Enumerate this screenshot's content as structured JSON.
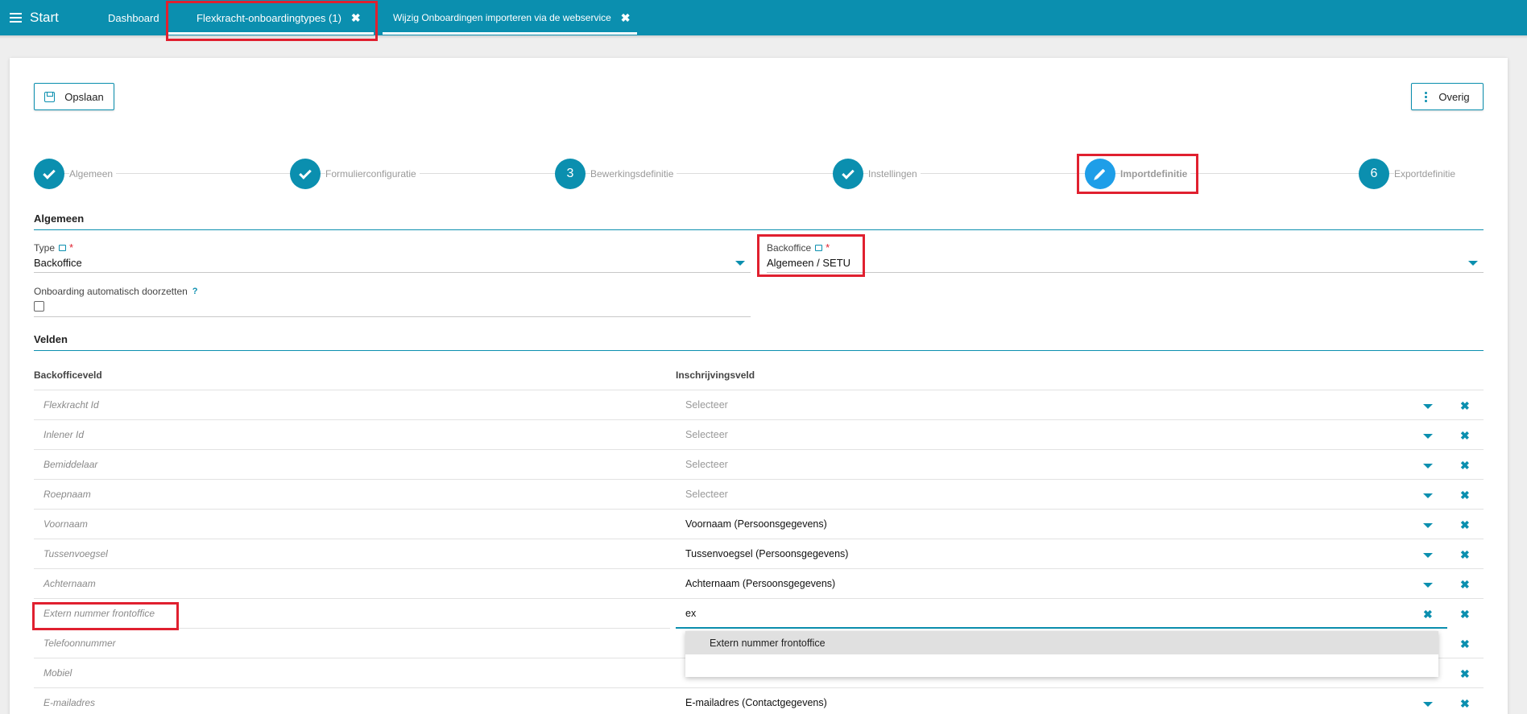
{
  "topbar": {
    "start_label": "Start",
    "tabs": [
      {
        "label": "Dashboard"
      },
      {
        "label": "Flexkracht-onboardingtypes (1)",
        "close": "✖"
      },
      {
        "label": "Wijzig Onboardingen importeren via de webservice",
        "close": "✖"
      }
    ]
  },
  "toolbar": {
    "save_label": "Opslaan",
    "overig_label": "Overig"
  },
  "stepper": {
    "steps": [
      {
        "label": "Algemeen",
        "state": "done"
      },
      {
        "label": "Formulierconfiguratie",
        "state": "done"
      },
      {
        "label": "Bewerkingsdefinitie",
        "state": "number",
        "number": "3"
      },
      {
        "label": "Instellingen",
        "state": "done"
      },
      {
        "label": "Importdefinitie",
        "state": "active"
      },
      {
        "label": "Exportdefinitie",
        "state": "number",
        "number": "6"
      }
    ]
  },
  "algemeen": {
    "title": "Algemeen",
    "type_label": "Type",
    "type_value": "Backoffice",
    "backoffice_label": "Backoffice",
    "backoffice_value": "Algemeen / SETU",
    "auto_label": "Onboarding automatisch doorzetten",
    "help": "?",
    "required": "*"
  },
  "velden": {
    "title": "Velden",
    "col_backoffice": "Backofficeveld",
    "col_inschrijving": "Inschrijvingsveld",
    "rows": [
      {
        "backoffice": "Flexkracht Id",
        "value": "Selecteer",
        "placeholder": true
      },
      {
        "backoffice": "Inlener Id",
        "value": "Selecteer",
        "placeholder": true
      },
      {
        "backoffice": "Bemiddelaar",
        "value": "Selecteer",
        "placeholder": true
      },
      {
        "backoffice": "Roepnaam",
        "value": "Selecteer",
        "placeholder": true
      },
      {
        "backoffice": "Voornaam",
        "value": "Voornaam (Persoonsgegevens)",
        "placeholder": false
      },
      {
        "backoffice": "Tussenvoegsel",
        "value": "Tussenvoegsel (Persoonsgegevens)",
        "placeholder": false
      },
      {
        "backoffice": "Achternaam",
        "value": "Achternaam (Persoonsgegevens)",
        "placeholder": false
      },
      {
        "backoffice": "Extern nummer frontoffice",
        "value": "ex",
        "placeholder": false
      },
      {
        "backoffice": "Telefoonnummer",
        "value": "",
        "placeholder": false
      },
      {
        "backoffice": "Mobiel",
        "value": "",
        "placeholder": false
      },
      {
        "backoffice": "E-mailadres",
        "value": "E-mailadres (Contactgegevens)",
        "placeholder": false
      }
    ],
    "remove_glyph": "✖",
    "clear_glyph": "✖"
  },
  "dropdown": {
    "options": [
      {
        "label": "Extern nummer frontoffice"
      }
    ]
  },
  "colors": {
    "primary": "#0b8faf",
    "active_step": "#1e9ee8",
    "highlight": "#e0202f"
  }
}
